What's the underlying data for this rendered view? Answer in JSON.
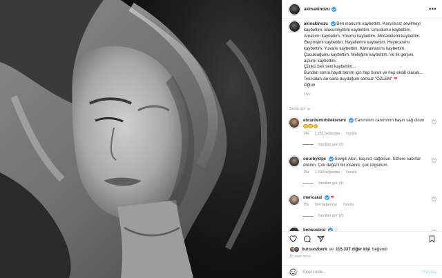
{
  "post": {
    "author": "akinakinozu",
    "photo_alt": "",
    "more_icon": "more-horizontal-icon"
  },
  "caption": {
    "author": "akinakinozu",
    "lines": [
      "Ben inancımı kaybettim. Karşılıksız sevilmeyi",
      "kaybettim. Masumiyetimi kaybettim. Umudumu kaybettim.",
      "Amacımı kaybettim. Yolumu kaybettim. Mücadelemi kaybettim.",
      "Geçmişimi kaybettim. Hayallerimi kaybettim. Heyecanımı",
      "kaybettim. Yuvamı kaybettim. Kahramanımı kaybettim.",
      "Çocukluğumu kaybettim. Meleğimi kaybettim. Ve ilk gerçek",
      "aşkımı kaybettim.",
      "Çünkü ben seni kaybettim...",
      "Bundan sonra hayat benim için hep buruk ve hep eksik olacak...",
      "Tek kalan ise sana duyduğum sonsuz \"ÖZLEM\"",
      "Oğlun"
    ],
    "heart": "❤",
    "time": "15s"
  },
  "section_label": "Senin için",
  "comments": [
    {
      "user": "ebrardemirbilekresmi",
      "text": "Canımmm canımmm başın sağ olsun",
      "emoji_count": 3,
      "time": "14s",
      "likes": "1.251 beğenme",
      "reply": "Yanıtla",
      "replies": "Yanıtları gör (3)"
    },
    {
      "user": "onurbyktpc",
      "text": "Sevgili Akın, başınız sağolsun. Sizlere sabırlar",
      "text2": "dilerim. Çok değerli bir insandı, çok üzgünüm.",
      "time": "15s",
      "likes": "1.493 beğenme",
      "reply": "Yanıtla",
      "replies": "Yanıtları gör (4)"
    },
    {
      "user": "mericaral",
      "text": "",
      "heart": "❤",
      "time": "15s",
      "likes": "594 beğenme",
      "reply": "Yanıtla",
      "replies": "Yanıtları gör (2)"
    },
    {
      "user": "bensusoral",
      "text": "",
      "heart": "♡"
    }
  ],
  "likes": {
    "first_user": "burcuozberk",
    "joiner": "ve",
    "count": "115.337 diğer kişi",
    "suffix": "beğendi"
  },
  "time_ago": "15 saat önce",
  "add_comment": {
    "placeholder": "Yorum ekle...",
    "post_label": "Paylaş"
  },
  "icons": [
    "heart-icon",
    "comment-icon",
    "share-icon",
    "bookmark-icon",
    "emoji-icon"
  ],
  "colors": {
    "verified": "#3897f0",
    "heart_red": "#ed4956",
    "muted_text": "#8e8e8e",
    "post_button": "#b2dffc"
  }
}
